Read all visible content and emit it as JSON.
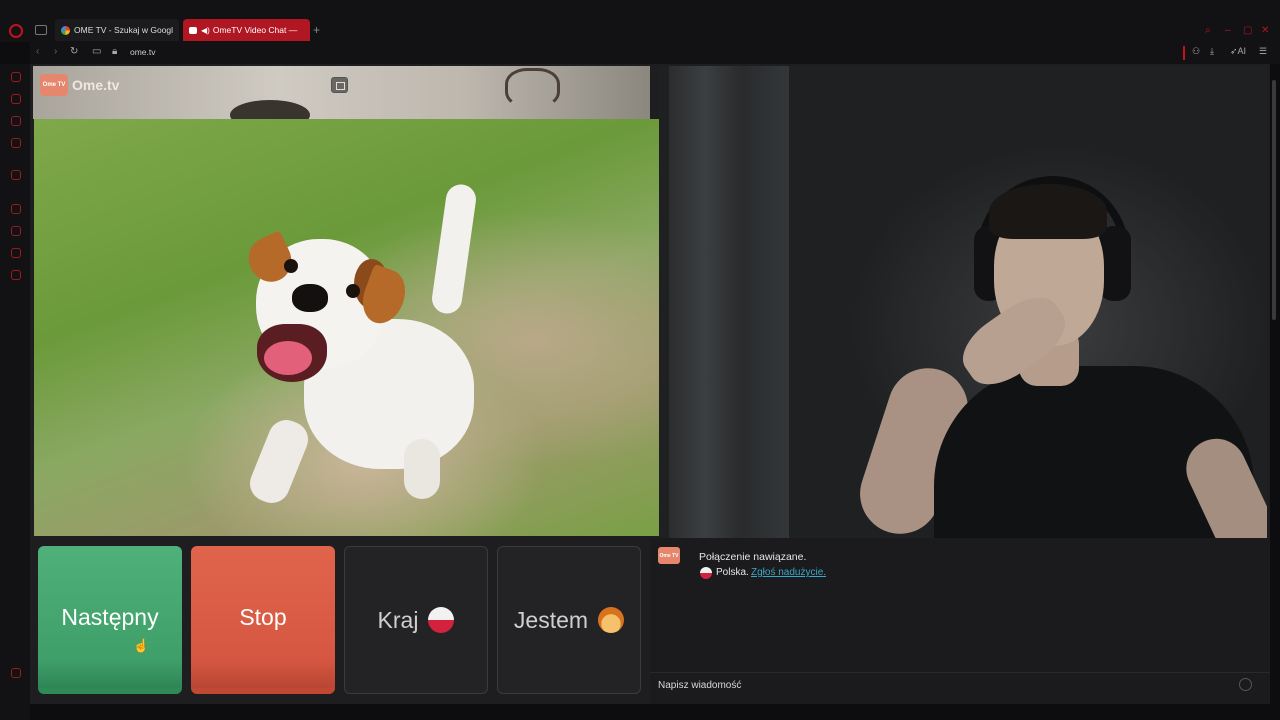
{
  "browser": {
    "tabs": [
      {
        "label": "OME TV - Szukaj w Googl"
      },
      {
        "label": "OmeTV Video Chat —"
      }
    ],
    "url": "ome.tv",
    "ai_label": "AI"
  },
  "app": {
    "logo_box": "Ome TV",
    "logo_text": "Ome.tv"
  },
  "controls": {
    "next_label": "Następny",
    "stop_label": "Stop",
    "country_label": "Kraj",
    "gender_label": "Jestem"
  },
  "chat": {
    "status": "Połączenie nawiązane.",
    "country": "Polska.",
    "report_link": "Zgłoś nadużycie.",
    "input_placeholder": "Napisz wiadomość"
  },
  "icons": {
    "country_flag": "poland-flag-icon",
    "gender": "person-emoji-icon"
  },
  "colors": {
    "next": "#43a46e",
    "stop": "#d95a43",
    "opera_accent": "#c1121f",
    "link": "#3aa8c8"
  }
}
